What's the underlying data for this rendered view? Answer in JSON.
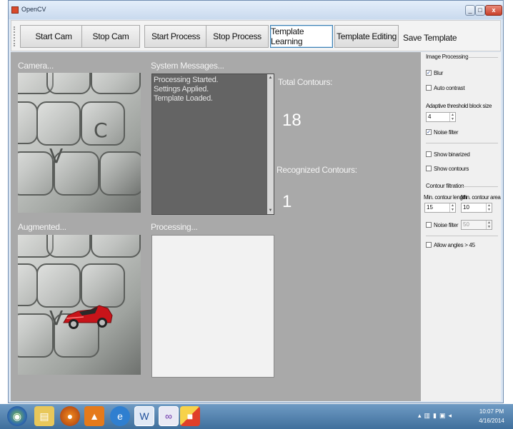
{
  "window": {
    "title": "OpenCV",
    "close_glyph": "x",
    "min_glyph": "_",
    "max_glyph": "□"
  },
  "toolbar": {
    "buttons": [
      "Start Cam",
      "Stop Cam",
      "Start Process",
      "Stop Process",
      "Template Learning",
      "Template Editing"
    ],
    "save_label": "Save Template",
    "active_button": "Template Learning"
  },
  "camera": {
    "label": "Camera..."
  },
  "system_messages": {
    "label": "System Messages...",
    "lines": [
      "Processing Started.",
      "Settings Applied.",
      "Template Loaded."
    ]
  },
  "augmented": {
    "label": "Augmented..."
  },
  "processing": {
    "label": "Processing..."
  },
  "contours": {
    "total_label": "Total Contours:",
    "total_value": "18",
    "recognized_label": "Recognized Contours:",
    "recognized_value": "1"
  },
  "image_processing": {
    "title": "Image Processing",
    "blur": {
      "label": "Blur",
      "checked": true
    },
    "auto_contrast": {
      "label": "Auto contrast",
      "checked": false
    },
    "adaptive_label": "Adaptive threshold block size",
    "adaptive_value": "4",
    "noise_filter": {
      "label": "Noise filter",
      "checked": true
    },
    "show_binarized": {
      "label": "Show binarized",
      "checked": false
    },
    "show_contours": {
      "label": "Show contours",
      "checked": false
    }
  },
  "contour_filtration": {
    "title": "Contour filtration",
    "min_length_label": "Min. contour length",
    "min_length_value": "15",
    "min_area_label": "Min. contour area",
    "min_area_value": "10",
    "noise_filter": {
      "label": "Noise filter",
      "checked": false
    },
    "noise_filter_value": "50",
    "allow_angles": {
      "label": "Allow angles > 45",
      "checked": false
    }
  },
  "taskbar": {
    "icons": [
      "start-orb",
      "explorer",
      "firefox",
      "vlc",
      "internet-explorer",
      "word",
      "visual-studio",
      "paint"
    ],
    "clock_time": "10:07 PM",
    "clock_date": "4/16/2014"
  },
  "colors": {
    "accent_border": "#3c7fb1",
    "client_bg": "#a9a9a9",
    "message_bg": "#646464"
  },
  "check_glyph": "✓"
}
